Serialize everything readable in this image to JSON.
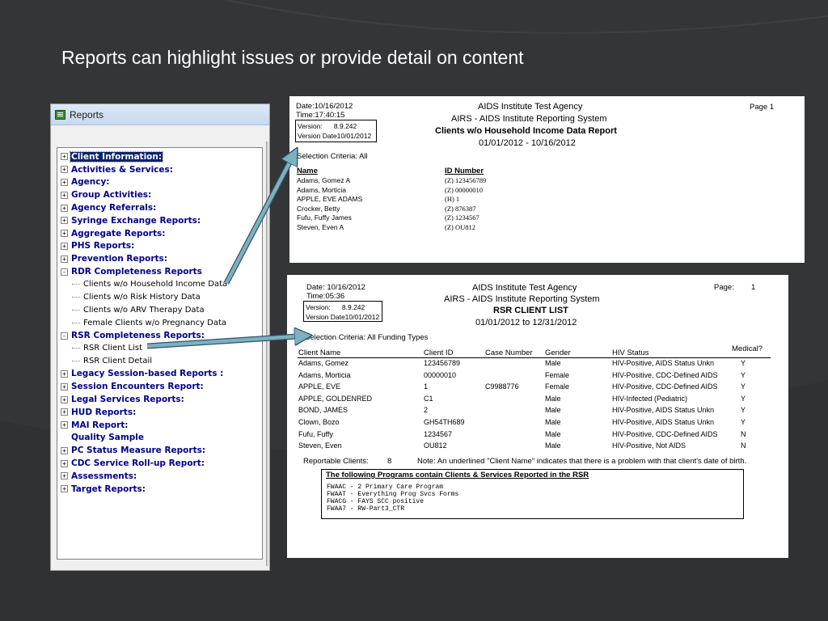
{
  "slide": {
    "title": "Reports can highlight issues or provide detail on content"
  },
  "colors": {
    "background": "#333536",
    "tree_category": "#00008b",
    "selection": "#0a246a",
    "arrow": "#6aa0b5"
  },
  "tree_window": {
    "title": "Reports",
    "icon": "report-window-icon",
    "items": [
      {
        "label": "Client Information:",
        "level": 0,
        "expander": "+",
        "selected": true
      },
      {
        "label": "Activities & Services:",
        "level": 0,
        "expander": "+"
      },
      {
        "label": "Agency:",
        "level": 0,
        "expander": "+"
      },
      {
        "label": "Group Activities:",
        "level": 0,
        "expander": "+"
      },
      {
        "label": "Agency Referrals:",
        "level": 0,
        "expander": "+"
      },
      {
        "label": "Syringe Exchange Reports:",
        "level": 0,
        "expander": "+"
      },
      {
        "label": "Aggregate Reports:",
        "level": 0,
        "expander": "+"
      },
      {
        "label": "PHS Reports:",
        "level": 0,
        "expander": "+"
      },
      {
        "label": "Prevention Reports:",
        "level": 0,
        "expander": "+"
      },
      {
        "label": "RDR Completeness Reports",
        "level": 0,
        "expander": "-"
      },
      {
        "label": "Clients w/o Household Income Data",
        "level": 1
      },
      {
        "label": "Clients w/o Risk History Data",
        "level": 1
      },
      {
        "label": "Clients w/o ARV Therapy Data",
        "level": 1
      },
      {
        "label": "Female Clients w/o Pregnancy Data",
        "level": 1
      },
      {
        "label": "RSR Completeness Reports:",
        "level": 0,
        "expander": "-"
      },
      {
        "label": "RSR Client List",
        "level": 1
      },
      {
        "label": "RSR Client Detail",
        "level": 1
      },
      {
        "label": "Legacy Session-based Reports :",
        "level": 0,
        "expander": "+"
      },
      {
        "label": "Session Encounters Report:",
        "level": 0,
        "expander": "+"
      },
      {
        "label": "Legal Services Reports:",
        "level": 0,
        "expander": "+"
      },
      {
        "label": "HUD Reports:",
        "level": 0,
        "expander": "+"
      },
      {
        "label": "MAI Report:",
        "level": 0,
        "expander": "+"
      },
      {
        "label": "Quality Sample",
        "level": 0,
        "expander": ""
      },
      {
        "label": "PC Status Measure Reports:",
        "level": 0,
        "expander": "+"
      },
      {
        "label": "CDC Service Roll-up Report:",
        "level": 0,
        "expander": "+"
      },
      {
        "label": "Assessments:",
        "level": 0,
        "expander": "+"
      },
      {
        "label": "Target Reports:",
        "level": 0,
        "expander": "+"
      }
    ]
  },
  "report1": {
    "date_label": "Date:",
    "date": "10/16/2012",
    "time_label": "Time:",
    "time": "17:40:15",
    "version_label": "Version:",
    "version": "8.9.242",
    "version_date_label": "Version Date",
    "version_date": "10/01/2012",
    "agency": "AIDS Institute Test Agency",
    "system": "AIRS - AIDS Institute Reporting System",
    "report_title": "Clients w/o Household Income Data Report",
    "date_range": "01/01/2012 - 10/16/2012",
    "page": "Page 1",
    "selection_criteria": "Selection Criteria: All",
    "col_name": "Name",
    "col_id": "ID Number",
    "rows": [
      {
        "name": "Adams, Gomez A",
        "id": "(Z) 123456789"
      },
      {
        "name": "Adams, Morticia",
        "id": "(Z) 00000010"
      },
      {
        "name": "APPLE, EVE ADAMS",
        "id": "(H) 1"
      },
      {
        "name": "Crocker, Betty",
        "id": "(Z) 876387"
      },
      {
        "name": "Fufu, Fuffy James",
        "id": "(Z) 1234567"
      },
      {
        "name": "Steven, Even A",
        "id": "(Z) OU812"
      }
    ]
  },
  "report2": {
    "date_label": "Date:",
    "date": "10/16/2012",
    "time_label": "Time:",
    "time": "05:36",
    "version_label": "Version:",
    "version": "8.9.242",
    "version_date_label": "Version Date",
    "version_date": "10/01/2012",
    "agency": "AIDS Institute Test Agency",
    "system": "AIRS - AIDS Institute Reporting System",
    "report_title": "RSR CLIENT LIST",
    "date_range": "01/01/2012 to 12/31/2012",
    "page_label": "Page:",
    "page": "1",
    "selection_criteria": "Selection Criteria: All Funding Types",
    "columns": {
      "name": "Client Name",
      "id": "Client ID",
      "case": "Case Number",
      "gender": "Gender",
      "hiv": "HIV Status",
      "medical": "Medical?"
    },
    "rows": [
      {
        "name": "Adams, Gomez",
        "id": "123456789",
        "case": "",
        "gender": "Male",
        "hiv": "HIV-Positive, AIDS Status Unkn",
        "medical": "Y"
      },
      {
        "name": "Adams, Morticia",
        "id": "00000010",
        "case": "",
        "gender": "Female",
        "hiv": "HIV-Positive, CDC-Defined AIDS",
        "medical": "Y"
      },
      {
        "name": "APPLE, EVE",
        "id": "1",
        "case": "C9988776",
        "gender": "Female",
        "hiv": "HIV-Positive, CDC-Defined AIDS",
        "medical": "Y"
      },
      {
        "name": "APPLE, GOLDENRED",
        "id": "C1",
        "case": "",
        "gender": "Male",
        "hiv": "HIV-Infected (Pediatric)",
        "medical": "Y"
      },
      {
        "name": "BOND, JAMES",
        "id": "2",
        "case": "",
        "gender": "Male",
        "hiv": "HIV-Positive, AIDS Status Unkn",
        "medical": "Y"
      },
      {
        "name": "Clown, Bozo",
        "id": "GH54TH689",
        "case": "",
        "gender": "Male",
        "hiv": "HIV-Positive, AIDS Status Unkn",
        "medical": "Y"
      },
      {
        "name": "Fufu, Fuffy",
        "id": "1234567",
        "case": "",
        "gender": "Male",
        "hiv": "HIV-Positive, CDC-Defined AIDS",
        "medical": "N"
      },
      {
        "name": "Steven, Even",
        "id": "OU812",
        "case": "",
        "gender": "Male",
        "hiv": "HIV-Positive, Not AIDS",
        "medical": "N"
      }
    ],
    "reportable_label": "Reportable Clients:",
    "reportable_count": "8",
    "note": "Note: An underlined \"Client Name\" indicates that there is a problem with that client's date of birth.",
    "programs_title": "The following Programs contain Clients & Services Reported in the RSR",
    "programs": [
      "FWAAC - 2 Primary Care Program",
      "FWAAT - Everything Prog Svcs Forms",
      "FWACG - FAYS SCC positive",
      "FWAA7 - RW-Part3_CTR"
    ]
  }
}
